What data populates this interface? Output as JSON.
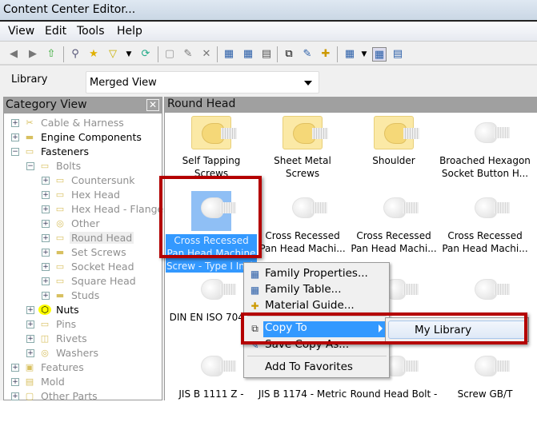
{
  "window": {
    "title": "Content Center Editor..."
  },
  "menubar": [
    "View",
    "Edit",
    "Tools",
    "Help"
  ],
  "toolbar": {
    "icons": [
      "back-icon",
      "forward-icon",
      "up-folder-icon",
      "search-icon",
      "favorites-star-icon",
      "filter-icon",
      "filter-dropdown-icon",
      "refresh-icon",
      "new-category-icon",
      "edit-category-icon",
      "delete-category-icon",
      "family-properties-icon",
      "family-table-icon",
      "table-view-icon",
      "copy-to-icon",
      "save-copy-icon",
      "material-guide-icon",
      "view-options-icon",
      "view-dropdown-icon",
      "large-icons-view-icon",
      "details-view-icon"
    ]
  },
  "library": {
    "label": "Library",
    "value": "Merged View"
  },
  "category_view": {
    "title": "Category View",
    "close": "✕",
    "items": [
      {
        "label": "Cable & Harness",
        "level": 0
      },
      {
        "label": "Engine Components",
        "level": 0
      },
      {
        "label": "Fasteners",
        "level": 0
      },
      {
        "label": "Bolts",
        "level": 1
      },
      {
        "label": "Countersunk",
        "level": 2
      },
      {
        "label": "Hex Head",
        "level": 2
      },
      {
        "label": "Hex Head - Flanged",
        "level": 2
      },
      {
        "label": "Other",
        "level": 2
      },
      {
        "label": "Round Head",
        "level": 2
      },
      {
        "label": "Set Screws",
        "level": 2
      },
      {
        "label": "Socket Head",
        "level": 2
      },
      {
        "label": "Square Head",
        "level": 2
      },
      {
        "label": "Studs",
        "level": 2
      },
      {
        "label": "Nuts",
        "level": 1
      },
      {
        "label": "Pins",
        "level": 1
      },
      {
        "label": "Rivets",
        "level": 1
      },
      {
        "label": "Washers",
        "level": 1
      },
      {
        "label": "Features",
        "level": 0
      },
      {
        "label": "Mold",
        "level": 0
      },
      {
        "label": "Other Parts",
        "level": 0
      }
    ]
  },
  "content": {
    "title": "Round Head",
    "items": [
      {
        "label": "Self Tapping Screws",
        "type": "folder"
      },
      {
        "label": "Sheet Metal Screws",
        "type": "folder"
      },
      {
        "label": "Shoulder",
        "type": "folder"
      },
      {
        "label": "Broached Hexagon Socket Button H...",
        "type": "family"
      },
      {
        "label": "Cross Recessed Pan Head Machine Screw - Type I Inch",
        "type": "family",
        "selected": true
      },
      {
        "label": "Cross Recessed Pan Head Machi...",
        "type": "family"
      },
      {
        "label": "Cross Recessed Pan Head Machi...",
        "type": "family"
      },
      {
        "label": "Cross Recessed Pan Head Machi...",
        "type": "family"
      },
      {
        "label": "DIN EN ISO 704...",
        "type": "family"
      },
      {
        "label": "",
        "type": "family"
      },
      {
        "label": "",
        "type": "family"
      },
      {
        "label": "",
        "type": "family"
      },
      {
        "label": "JIS B 1111 Z -",
        "type": "family"
      },
      {
        "label": "JIS B 1174 - Metric",
        "type": "family"
      },
      {
        "label": "Round Head Bolt -",
        "type": "family"
      },
      {
        "label": "Screw GB/T",
        "type": "family"
      }
    ]
  },
  "context_menu": {
    "items": [
      "Family Properties...",
      "Family Table...",
      "Material Guide...",
      "Copy To",
      "Save Copy As...",
      "Add To Favorites"
    ],
    "highlighted": "Copy To",
    "submenu": {
      "items": [
        "My Library"
      ]
    }
  },
  "colors": {
    "highlight": "#3399ff",
    "annotation": "#b40000",
    "panel_header": "#a0a0a0"
  }
}
